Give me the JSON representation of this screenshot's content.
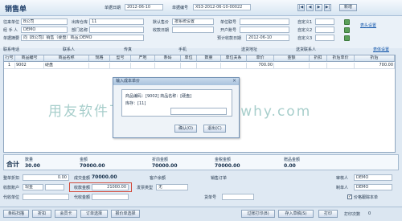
{
  "window": {
    "title": "销售单",
    "doc_date_label": "单据日期",
    "doc_date": "2012-06-10",
    "doc_no_label": "单据编号",
    "doc_no": "XS3-2012-06-10-00022",
    "nav": [
      "|◀",
      "◀",
      "▶",
      "▶|"
    ],
    "new_label": "新增"
  },
  "header": {
    "customer_label": "往来单位",
    "customer_value": "B公司",
    "shipping_label": "出库仓库",
    "shipping_value": "11",
    "price_tier_label": "默认售价",
    "price_tier_value": "按系统设置",
    "invoice_label": "单位联号",
    "custom1_label": "自定义1",
    "settings_link": "表头设置",
    "handler_label": "经 手 人",
    "handler_value": "DEMO",
    "dept_label": "部门名称",
    "payment_label": "收款日期",
    "account_label": "开户账号",
    "custom2_label": "自定义2",
    "summary_label": "单据摘要",
    "summary_value": "向【B公司】销售（硬盘）商品;DEMO",
    "promo_label": "预计收款日期",
    "promo_date": "2012-06-10",
    "custom3_label": "自定义3",
    "contact_label": "联系电话",
    "contact_person_label": "联系人",
    "fax_label": "传真",
    "mobile_label": "手机",
    "ship_addr_label": "送货地址",
    "recv_person_label": "送货联系人",
    "table_settings_link": "表体设置"
  },
  "grid": {
    "columns": [
      "行号",
      "商品编号",
      "商品名称",
      "规格",
      "型号",
      "产地",
      "条码",
      "单位",
      "数量",
      "单位关系",
      "单价",
      "金额",
      "折扣",
      "折后单价",
      "折后"
    ],
    "rows": [
      [
        "1",
        "9002",
        "硬盘",
        "",
        "",
        "",
        "",
        "",
        "",
        "",
        "700.00",
        "",
        "",
        "",
        "700.00"
      ]
    ]
  },
  "dialog": {
    "title": "输入成本单价",
    "product_label": "商品编码：[9002] 商品名称：[硬盘]",
    "warehouse_label": "库存：[11]",
    "ok_label": "确认(O)",
    "cancel_label": "退出(C)"
  },
  "watermark": "用友软件下载：www.ufidawhy.com",
  "summary": {
    "total_label": "合计",
    "qty_label": "数量",
    "qty_value": "30.00",
    "amount_label": "金额",
    "amount_value": "70000.00",
    "disc_amount_label": "折前金额",
    "disc_amount_value": "70000.00",
    "tax_amount_label": "金税金额",
    "tax_amount_value": "70000.00",
    "gift_label": "赠品金额",
    "gift_value": "0.00"
  },
  "footer": {
    "discount_label": "整单折扣",
    "discount_value": "0.00",
    "cost_amount_label": "成交金额",
    "cost_amount_value": "70000.00",
    "cust_balance_label": "客户余额",
    "order_label": "销售订单",
    "auditor_label": "审核人",
    "auditor_value": "DEMO",
    "account_type_label": "收款账户",
    "account_type_value": "现金",
    "collect_label": "收款金额",
    "collect_value": "21000.00",
    "invoice_type_label": "发票类型",
    "invoice_type_value": "无",
    "maker_label": "制单人",
    "maker_value": "DEMO",
    "agent_label": "代收单位",
    "agent2_label": "代收金额",
    "doc_count_label": "货单号",
    "price_track_label": "价格跟踪本单"
  },
  "bottom_buttons": [
    "条码扫描",
    "折扣",
    "会员卡",
    "订单选择",
    "报价单选择"
  ],
  "bottom_right_buttons": [
    "过账打印(B)",
    "存入草稿(S)",
    "打印"
  ],
  "print_count_label": "打印次数",
  "print_count_value": "0"
}
